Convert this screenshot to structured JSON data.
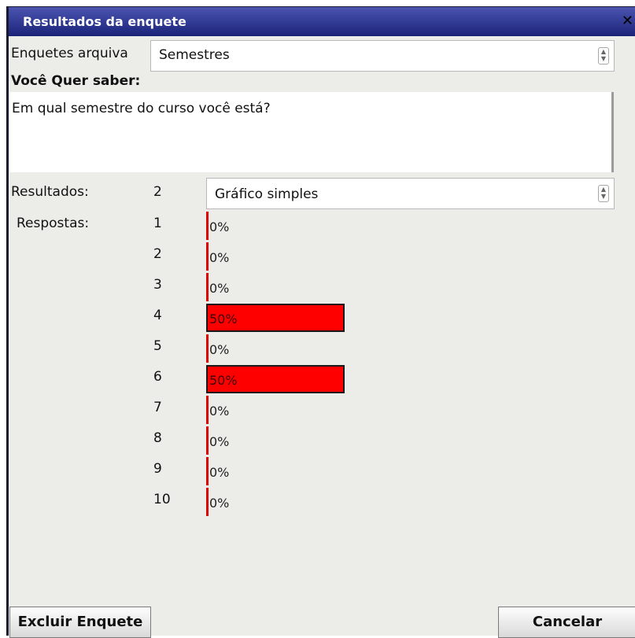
{
  "dialog": {
    "title": "Resultados da enquete",
    "close_glyph": "✕"
  },
  "archived": {
    "label": "Enquetes arquiva",
    "selected": "Semestres"
  },
  "question": {
    "label": "Você Quer saber:",
    "text": "Em qual semestre do curso você está?"
  },
  "results": {
    "label": "Resultados:",
    "count": "2",
    "view_selected": "Gráfico simples"
  },
  "answers": {
    "label": "Respostas:",
    "rows": [
      {
        "num": "1",
        "percent_label": "0%",
        "percent": 0
      },
      {
        "num": "2",
        "percent_label": "0%",
        "percent": 0
      },
      {
        "num": "3",
        "percent_label": "0%",
        "percent": 0
      },
      {
        "num": "4",
        "percent_label": "50%",
        "percent": 50
      },
      {
        "num": "5",
        "percent_label": "0%",
        "percent": 0
      },
      {
        "num": "6",
        "percent_label": "50%",
        "percent": 50
      },
      {
        "num": "7",
        "percent_label": "0%",
        "percent": 0
      },
      {
        "num": "8",
        "percent_label": "0%",
        "percent": 0
      },
      {
        "num": "9",
        "percent_label": "0%",
        "percent": 0
      },
      {
        "num": "10",
        "percent_label": "0%",
        "percent": 0
      }
    ],
    "bar_color": "#ff0000"
  },
  "buttons": {
    "delete": "Excluir Enquete",
    "cancel": "Cancelar"
  },
  "icons": {
    "close": "close-icon",
    "spinner": "spinner-arrows-icon"
  },
  "colors": {
    "titlebar": "#1b2379",
    "bar": "#ff0000",
    "background": "#ecece8"
  }
}
